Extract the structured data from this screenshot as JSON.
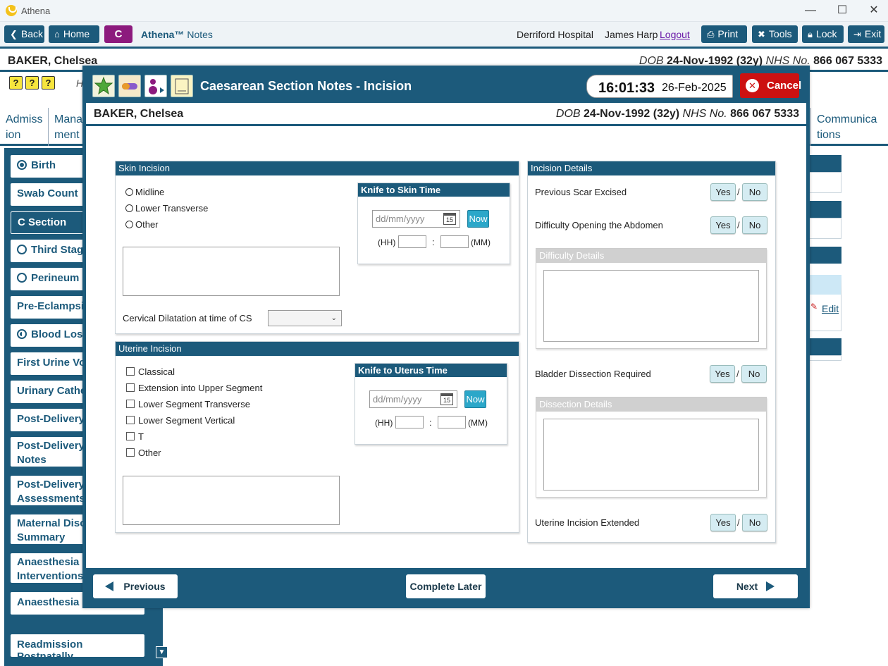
{
  "window": {
    "title": "Athena",
    "minimize": "—",
    "maximize": "☐",
    "close": "✕"
  },
  "toolbar": {
    "back": "Back",
    "home": "Home",
    "c_badge": "C",
    "brand_name": "Athena™",
    "brand_suffix": "Notes",
    "hospital": "Derriford Hospital",
    "user": "James Harp",
    "logout": "Logout",
    "print": "Print",
    "tools": "Tools",
    "lock": "Lock",
    "exit": "Exit"
  },
  "patient": {
    "name": "BAKER, Chelsea",
    "dob_label": "DOB",
    "dob": "24-Nov-1992 (32y)",
    "nhs_label": "NHS No.",
    "nhs": "866 067 5333"
  },
  "background": {
    "help_icons": [
      "?",
      "?",
      "?"
    ],
    "header_fragment": "H",
    "tabs": [
      {
        "line1": "Admiss",
        "line2": "ion"
      },
      {
        "line1": "Mana",
        "line2": "ment"
      },
      {
        "line1": "Communica",
        "line2": "tions"
      }
    ],
    "sidebar": [
      {
        "label": "Birth",
        "icon": "full"
      },
      {
        "label": "Swab Count"
      },
      {
        "label": "C Section",
        "active": true
      },
      {
        "label": "Third Stage",
        "icon": "empty"
      },
      {
        "label": "Perineum",
        "icon": "empty"
      },
      {
        "label": "Pre-Eclampsia"
      },
      {
        "label": "Blood Loss",
        "icon": "half"
      },
      {
        "label": "First Urine Voi"
      },
      {
        "label": "Urinary Cathe"
      },
      {
        "label": "Post-Delivery"
      },
      {
        "line1": "Post-Delivery",
        "line2": "Notes"
      },
      {
        "line1": "Post-Delivery",
        "line2": "Assessments"
      },
      {
        "line1": "Maternal Disc",
        "line2": "Summary"
      },
      {
        "line1": "Anaesthesia",
        "line2": "Interventions"
      },
      {
        "label": "Anaesthesia Fo"
      },
      {
        "label": "Readmission Postnatally"
      }
    ],
    "edit_link": "Edit"
  },
  "modal": {
    "title": "Caesarean Section Notes - Incision",
    "time": "16:01:33",
    "date": "26-Feb-2025",
    "cancel": "Cancel",
    "skin": {
      "header": "Skin Incision",
      "options": [
        "Midline",
        "Lower Transverse",
        "Other"
      ],
      "knife_header": "Knife to Skin Time",
      "date_placeholder": "dd/mm/yyyy",
      "cal_day": "15",
      "now": "Now",
      "hh": "(HH)",
      "colon": ":",
      "mm": "(MM)",
      "cervical_label": "Cervical Dilatation at time of CS"
    },
    "uterine": {
      "header": "Uterine Incision",
      "options": [
        "Classical",
        "Extension into Upper Segment",
        "Lower Segment Transverse",
        "Lower Segment Vertical",
        "T",
        "Other"
      ],
      "knife_header": "Knife to Uterus Time",
      "date_placeholder": "dd/mm/yyyy",
      "cal_day": "15",
      "now": "Now",
      "hh": "(HH)",
      "colon": ":",
      "mm": "(MM)"
    },
    "details": {
      "header": "Incision Details",
      "yes": "Yes",
      "no": "No",
      "slash": "/",
      "q1": "Previous Scar Excised",
      "q2": "Difficulty Opening the Abdomen",
      "difficulty_header": "Difficulty Details",
      "q3": "Bladder Dissection Required",
      "dissection_header": "Dissection Details",
      "q4": "Uterine Incision Extended"
    },
    "footer": {
      "previous": "Previous",
      "complete_later": "Complete Later",
      "next": "Next"
    }
  }
}
